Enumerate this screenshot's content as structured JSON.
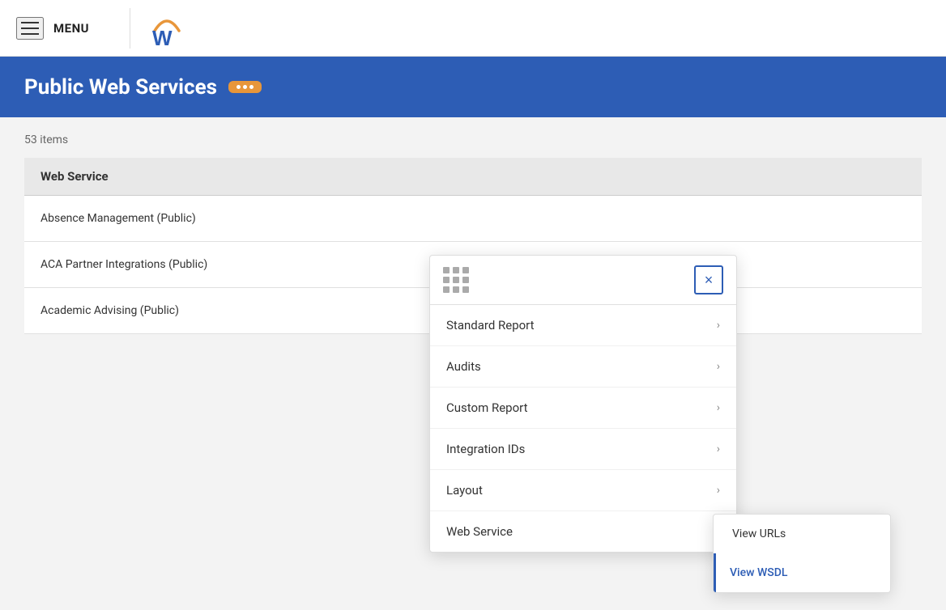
{
  "header": {
    "menu_label": "MENU",
    "logo_letter": "W"
  },
  "page": {
    "title": "Public Web Services",
    "more_button_label": "···",
    "items_count": "53 items"
  },
  "table": {
    "column_header": "Web Service",
    "rows": [
      {
        "name": "Absence Management (Public)"
      },
      {
        "name": "ACA Partner Integrations (Public)"
      },
      {
        "name": "Academic Advising (Public)"
      }
    ]
  },
  "dropdown": {
    "items": [
      {
        "label": "Standard Report",
        "id": "standard-report"
      },
      {
        "label": "Audits",
        "id": "audits"
      },
      {
        "label": "Custom Report",
        "id": "custom-report"
      },
      {
        "label": "Integration IDs",
        "id": "integration-ids"
      },
      {
        "label": "Layout",
        "id": "layout"
      },
      {
        "label": "Web Service",
        "id": "web-service"
      }
    ],
    "close_label": "×"
  },
  "submenu": {
    "items": [
      {
        "label": "View URLs",
        "active": false
      },
      {
        "label": "View WSDL",
        "active": true
      }
    ]
  }
}
